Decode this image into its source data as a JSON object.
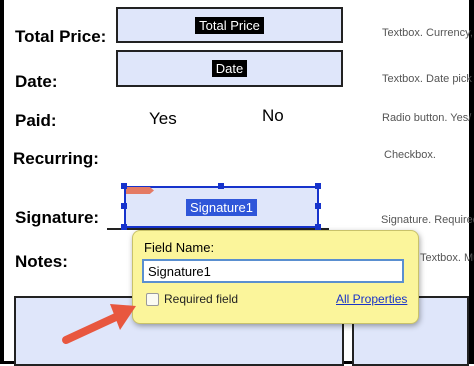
{
  "labels": {
    "total_price": "Total Price:",
    "date": "Date:",
    "paid": "Paid:",
    "recurring": "Recurring:",
    "signature": "Signature:",
    "notes": "Notes:"
  },
  "fields": {
    "total_price": "Total Price",
    "date": "Date",
    "signature": "Signature1"
  },
  "radio": {
    "yes": "Yes",
    "no": "No"
  },
  "notes_column": {
    "total_price": "Textbox. Currency,",
    "date": "Textbox. Date pick",
    "paid": "Radio button. Yes/",
    "recurring": "Checkbox.",
    "signature": "Signature. Required",
    "notes": "Textbox. Mu"
  },
  "popup": {
    "field_name_label": "Field Name:",
    "field_name_value": "Signature1",
    "required_label": "Required field",
    "required_checked": false,
    "all_properties": "All Properties"
  },
  "colors": {
    "field_fill": "#dfe6fa",
    "selection": "#1633cc",
    "popup_bg": "#fbf59b",
    "arrow": "#e8573f",
    "link": "#1a34c8"
  }
}
